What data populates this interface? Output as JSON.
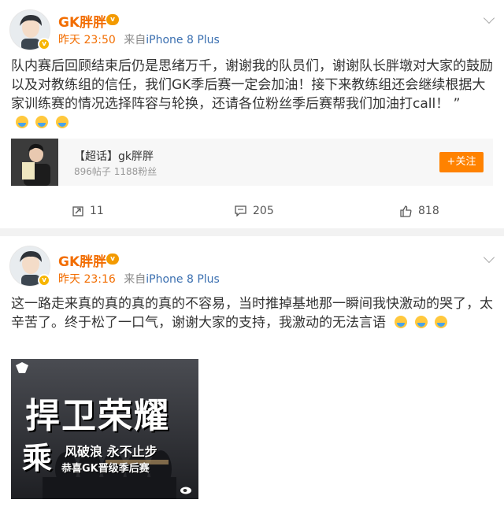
{
  "posts": [
    {
      "username": "GK胖胖",
      "time": "昨天 23:50",
      "source_prefix": "来自",
      "device": "iPhone 8 Plus",
      "text": "队内赛后回顾结束后仍是思绪万千，谢谢我的队员们，谢谢队长胖墩对大家的鼓励以及对教练组的信任，我们GK季后赛一定会加油！接下来教练组还会继续根据大家训练赛的情况选择阵容与轮换，还请各位粉丝季后赛帮我们加油打call！ ”",
      "card": {
        "title": "【超话】gk胖胖",
        "subtitle": "896帖子 1188粉丝",
        "follow_label": "+关注"
      },
      "actions": {
        "repost_count": "11",
        "comment_count": "205",
        "like_count": "818"
      }
    },
    {
      "username": "GK胖胖",
      "time": "昨天 23:16",
      "source_prefix": "来自",
      "device": "iPhone 8 Plus",
      "text": "这一路走来真的真的真的真的不容易，当时推掉基地那一瞬间我快激动的哭了，太辛苦了。终于松了一口气，谢谢大家的支持，我激动的无法言语",
      "media": {
        "headline": "捍卫荣耀",
        "big_char": "乘",
        "line1": "风破浪 永不止步",
        "line2": "恭喜GK晋级季后赛"
      }
    }
  ],
  "colors": {
    "username": "#f26d00",
    "follow_button": "#ff8200",
    "device_link": "#3a6fb0"
  }
}
